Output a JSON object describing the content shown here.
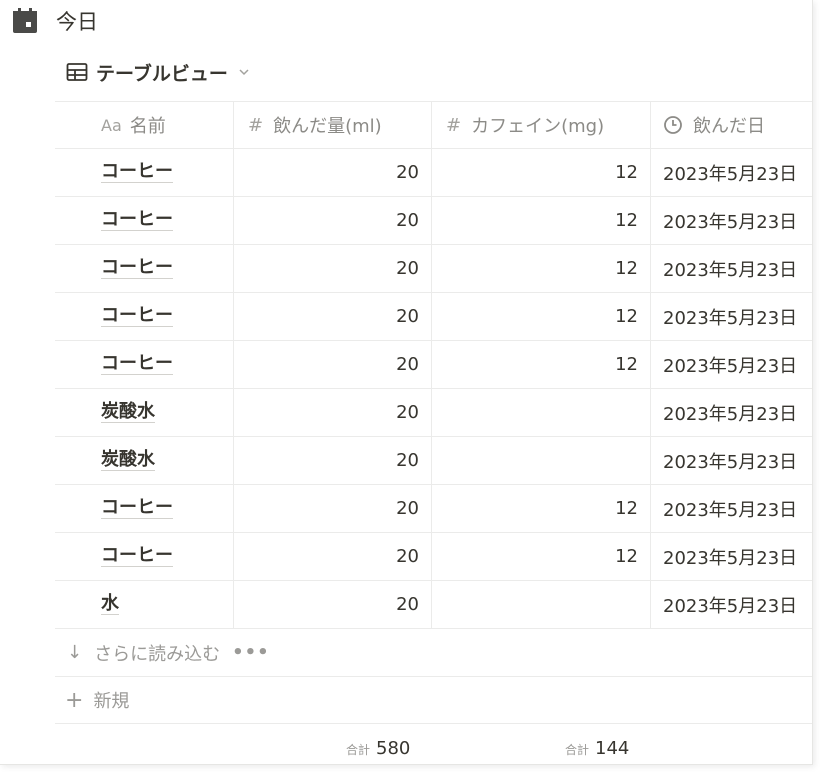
{
  "page": {
    "title": "今日"
  },
  "view": {
    "label": "テーブルビュー"
  },
  "columns": [
    {
      "label": "名前",
      "icon": "Aa"
    },
    {
      "label": "飲んだ量(ml)",
      "icon": "#"
    },
    {
      "label": "カフェイン(mg)",
      "icon": "#"
    },
    {
      "label": "飲んだ日",
      "icon": "clock-icon"
    }
  ],
  "rows": [
    {
      "name": "コーヒー",
      "amount": "20",
      "caffeine": "12",
      "date": "2023年5月23日"
    },
    {
      "name": "コーヒー",
      "amount": "20",
      "caffeine": "12",
      "date": "2023年5月23日"
    },
    {
      "name": "コーヒー",
      "amount": "20",
      "caffeine": "12",
      "date": "2023年5月23日"
    },
    {
      "name": "コーヒー",
      "amount": "20",
      "caffeine": "12",
      "date": "2023年5月23日"
    },
    {
      "name": "コーヒー",
      "amount": "20",
      "caffeine": "12",
      "date": "2023年5月23日"
    },
    {
      "name": "炭酸水",
      "amount": "20",
      "caffeine": "",
      "date": "2023年5月23日"
    },
    {
      "name": "炭酸水",
      "amount": "20",
      "caffeine": "",
      "date": "2023年5月23日"
    },
    {
      "name": "コーヒー",
      "amount": "20",
      "caffeine": "12",
      "date": "2023年5月23日"
    },
    {
      "name": "コーヒー",
      "amount": "20",
      "caffeine": "12",
      "date": "2023年5月23日"
    },
    {
      "name": "水",
      "amount": "20",
      "caffeine": "",
      "date": "2023年5月23日"
    }
  ],
  "load_more": {
    "label": "さらに読み込む",
    "dots": "•••"
  },
  "new_row": {
    "label": "新規"
  },
  "summary": {
    "amount_label": "合計",
    "amount_value": "580",
    "caffeine_label": "合計",
    "caffeine_value": "144"
  },
  "colors": {
    "text": "#37352f",
    "muted": "#9b9a97",
    "border": "#ebebea"
  }
}
